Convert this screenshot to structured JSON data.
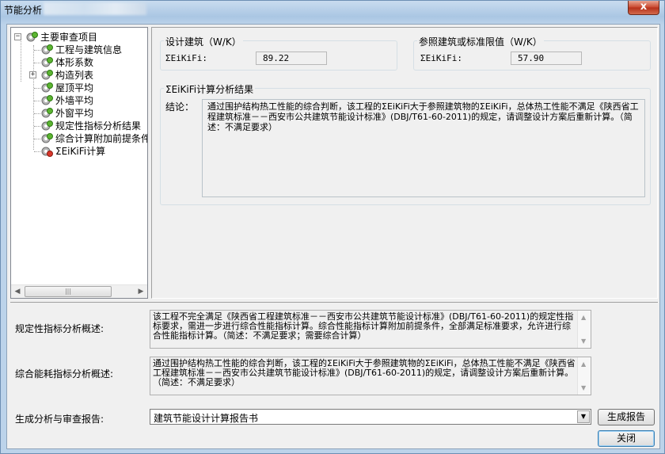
{
  "window": {
    "title": "节能分析",
    "close_glyph": "x"
  },
  "tree": {
    "root": {
      "label": "主要审查项目",
      "expander": "−"
    },
    "items": [
      {
        "label": "工程与建筑信息"
      },
      {
        "label": "体形系数"
      },
      {
        "label": "构造列表",
        "expander": "+"
      },
      {
        "label": "屋顶平均"
      },
      {
        "label": "外墙平均"
      },
      {
        "label": "外窗平均"
      },
      {
        "label": "规定性指标分析结果"
      },
      {
        "label": "综合计算附加前提条件"
      },
      {
        "label": "ΣEiKiFi计算"
      }
    ],
    "scroll_thumb_grip": "|||"
  },
  "design_group": {
    "title": "设计建筑（W/K）",
    "sum_label": "ΣEiKiFi:",
    "value": "89.22"
  },
  "reference_group": {
    "title": "参照建筑或标准限值（W/K）",
    "sum_label": "ΣEiKiFi:",
    "value": "57.90"
  },
  "result_group": {
    "title": "ΣEiKiFi计算分析结果",
    "conclusion_label": "结论：",
    "conclusion_text": "通过围护结构热工性能的综合判断，该工程的ΣEiKiFi大于参照建筑物的ΣEiKiFi，总体热工性能不满足《陕西省工程建筑标准－－西安市公共建筑节能设计标准》(DBJ/T61-60-2011)的规定，请调整设计方案后重新计算。（简述：不满足要求）"
  },
  "prescriptive": {
    "label": "规定性指标分析概述:",
    "text": "该工程不完全满足《陕西省工程建筑标准－－西安市公共建筑节能设计标准》(DBJ/T61-60-2011)的规定性指标要求，需进一步进行综合性能指标计算。综合性能指标计算附加前提条件，全部满足标准要求，允许进行综合性能指标计算。（简述：不满足要求；需要综合计算）"
  },
  "energy": {
    "label": "综合能耗指标分析概述:",
    "text": "通过围护结构热工性能的综合判断，该工程的ΣEiKiFi大于参照建筑物的ΣEiKiFi，总体热工性能不满足《陕西省工程建筑标准－－西安市公共建筑节能设计标准》(DBJ/T61-60-2011)的规定，请调整设计方案后重新计算。（简述：不满足要求）"
  },
  "report": {
    "label": "生成分析与审查报告:",
    "selected": "建筑节能设计计算报告书",
    "generate_button": "生成报告",
    "close_button": "关闭"
  }
}
